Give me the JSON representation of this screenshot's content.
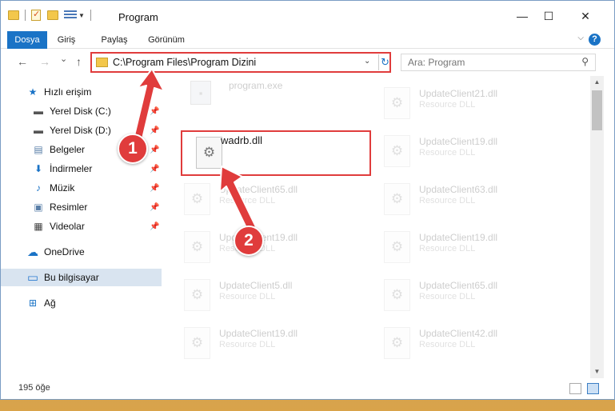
{
  "window": {
    "title": "Program",
    "minimize_glyph": "—",
    "maximize_glyph": "☐",
    "close_glyph": "✕"
  },
  "ribbon": {
    "tabs": [
      {
        "label": "Dosya",
        "active": true
      },
      {
        "label": "Giriş",
        "active": false
      },
      {
        "label": "Paylaş",
        "active": false
      },
      {
        "label": "Görünüm",
        "active": false
      }
    ],
    "collapse_glyph": "⌵",
    "help_glyph": "?"
  },
  "navigation": {
    "back_glyph": "←",
    "forward_glyph": "→",
    "recent_glyph": "⌄",
    "up_glyph": "↑",
    "address": "C:\\Program Files\\Program Dizini",
    "address_dropdown_glyph": "⌄",
    "refresh_glyph": "↻",
    "search_placeholder": "Ara: Program",
    "search_glyph": "⚲"
  },
  "sidebar": {
    "items": [
      {
        "label": "Hızlı erişim",
        "icon": "star-icon",
        "glyph": "★",
        "color": "#1a73c6",
        "pinned": false,
        "selected": false
      },
      {
        "label": "Yerel Disk (C:)",
        "icon": "drive-icon",
        "glyph": "▬",
        "color": "#555555",
        "pinned": true,
        "selected": false
      },
      {
        "label": "Yerel Disk (D:)",
        "icon": "drive-icon",
        "glyph": "▬",
        "color": "#555555",
        "pinned": true,
        "selected": false
      },
      {
        "label": "Belgeler",
        "icon": "documents-icon",
        "glyph": "▤",
        "color": "#5a7fa8",
        "pinned": true,
        "selected": false
      },
      {
        "label": "İndirmeler",
        "icon": "download-icon",
        "glyph": "⬇",
        "color": "#1a73c6",
        "pinned": true,
        "selected": false
      },
      {
        "label": "Müzik",
        "icon": "music-icon",
        "glyph": "♪",
        "color": "#1a73c6",
        "pinned": true,
        "selected": false
      },
      {
        "label": "Resimler",
        "icon": "pictures-icon",
        "glyph": "▣",
        "color": "#5a7fa8",
        "pinned": true,
        "selected": false
      },
      {
        "label": "Videolar",
        "icon": "videos-icon",
        "glyph": "▦",
        "color": "#444444",
        "pinned": true,
        "selected": false
      },
      {
        "label": "OneDrive",
        "icon": "cloud-icon",
        "glyph": "☁",
        "color": "#1a73c6",
        "pinned": false,
        "selected": false
      },
      {
        "label": "Bu bilgisayar",
        "icon": "computer-icon",
        "glyph": "▭",
        "color": "#2b7bd0",
        "pinned": false,
        "selected": true
      },
      {
        "label": "Ağ",
        "icon": "network-icon",
        "glyph": "⊞",
        "color": "#1a73c6",
        "pinned": false,
        "selected": false
      }
    ],
    "pin_glyph": "📌"
  },
  "files": {
    "left_column": [
      {
        "name": "program.exe",
        "type": "",
        "faded": true,
        "icon": "exe-icon"
      },
      {
        "name": "wadrb.dll",
        "type": "",
        "faded": false,
        "selected": true,
        "icon": "gear-icon"
      },
      {
        "name": "UpdateClient65.dll",
        "type": "Resource DLL",
        "faded": true,
        "icon": "gear-icon"
      },
      {
        "name": "UpdateClient19.dll",
        "type": "Resource DLL",
        "faded": true,
        "icon": "gear-icon"
      },
      {
        "name": "UpdateClient5.dll",
        "type": "Resource DLL",
        "faded": true,
        "icon": "gear-icon"
      },
      {
        "name": "UpdateClient19.dll",
        "type": "Resource DLL",
        "faded": true,
        "icon": "gear-icon"
      }
    ],
    "right_column": [
      {
        "name": "UpdateClient21.dll",
        "type": "Resource DLL",
        "faded": true,
        "icon": "gear-icon"
      },
      {
        "name": "UpdateClient19.dll",
        "type": "Resource DLL",
        "faded": true,
        "icon": "gear-icon"
      },
      {
        "name": "UpdateClient63.dll",
        "type": "Resource DLL",
        "faded": true,
        "icon": "gear-icon"
      },
      {
        "name": "UpdateClient19.dll",
        "type": "Resource DLL",
        "faded": true,
        "icon": "gear-icon"
      },
      {
        "name": "UpdateClient65.dll",
        "type": "Resource DLL",
        "faded": true,
        "icon": "gear-icon"
      },
      {
        "name": "UpdateClient42.dll",
        "type": "Resource DLL",
        "faded": true,
        "icon": "gear-icon"
      }
    ],
    "gear_glyph": "⚙"
  },
  "status": {
    "item_count": "195 öğe"
  },
  "annotations": {
    "badge_1": "1",
    "badge_2": "2",
    "color": "#e03c3c"
  }
}
